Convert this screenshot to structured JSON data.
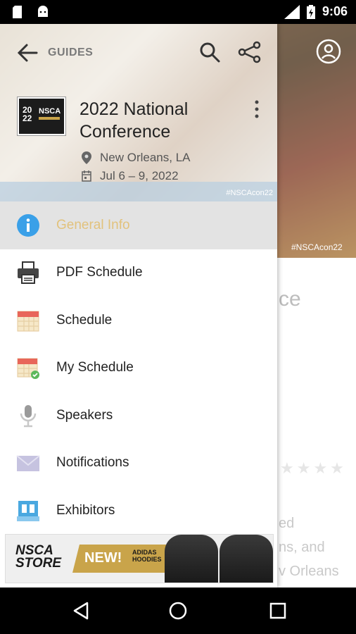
{
  "status": {
    "time": "9:06",
    "network": "LTE"
  },
  "background": {
    "hashtag": "#NSCAcon22",
    "partial_heading": "ce",
    "partial_lines": [
      "ed",
      "ns, and",
      "v Orleans"
    ]
  },
  "drawer": {
    "back_label": "GUIDES",
    "hashtag": "#NSCAcon22",
    "logo": {
      "year": "20\n22",
      "org": "NSCA"
    },
    "title": "2022 National Conference",
    "location": "New Orleans, LA",
    "dates": "Jul 6 – 9, 2022",
    "menu": [
      {
        "label": "General Info",
        "icon": "info-icon",
        "active": true
      },
      {
        "label": "PDF Schedule",
        "icon": "printer-icon",
        "active": false
      },
      {
        "label": "Schedule",
        "icon": "calendar-icon",
        "active": false
      },
      {
        "label": "My Schedule",
        "icon": "calendar-check-icon",
        "active": false
      },
      {
        "label": "Speakers",
        "icon": "microphone-icon",
        "active": false
      },
      {
        "label": "Notifications",
        "icon": "envelope-icon",
        "active": false
      },
      {
        "label": "Exhibitors",
        "icon": "booth-icon",
        "active": false
      }
    ],
    "banner": {
      "store_line1": "NSCA",
      "store_line2": "STORE",
      "new_text": "NEW!",
      "brand_line1": "ADIDAS",
      "brand_line2": "HOODIES"
    }
  },
  "colors": {
    "active_label": "#e2c27c",
    "info_blue": "#3aa0e8",
    "gold": "#c9a44a"
  }
}
